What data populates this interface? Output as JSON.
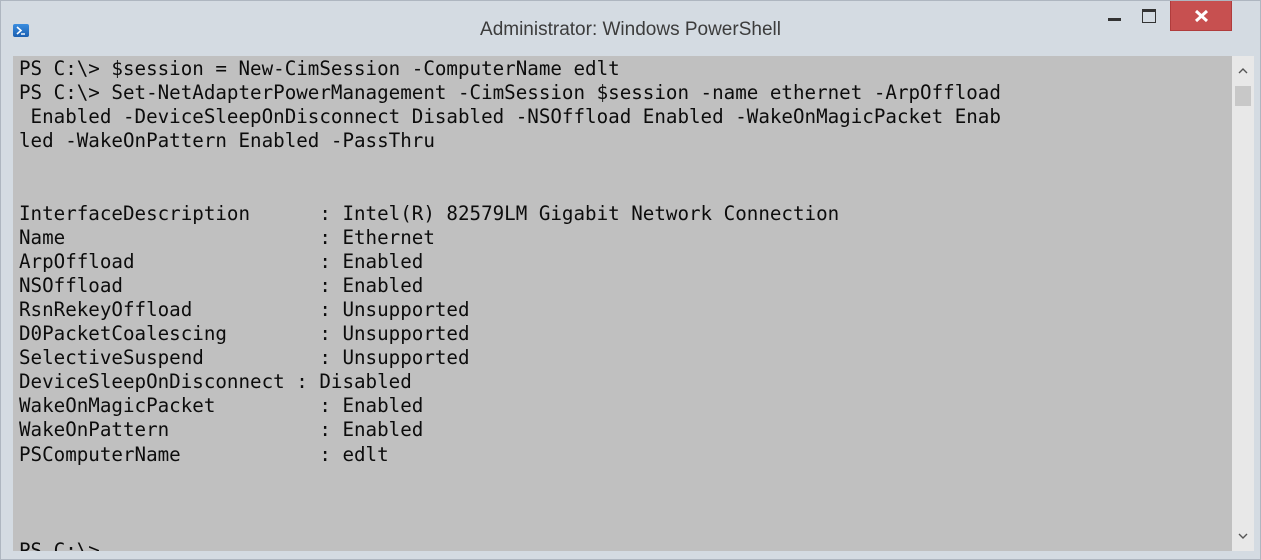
{
  "window": {
    "title": "Administrator: Windows PowerShell",
    "app_icon": "powershell-icon",
    "controls": {
      "minimize_icon": "minimize-icon",
      "maximize_icon": "maximize-icon",
      "close_icon": "close-icon",
      "close_color": "#c75050"
    }
  },
  "console": {
    "background_color": "#c0c0c0",
    "text_color": "#0c0c0c",
    "lines": [
      "PS C:\\> $session = New-CimSession -ComputerName edlt",
      "PS C:\\> Set-NetAdapterPowerManagement -CimSession $session -name ethernet -ArpOffload",
      " Enabled -DeviceSleepOnDisconnect Disabled -NSOffload Enabled -WakeOnMagicPacket Enab",
      "led -WakeOnPattern Enabled -PassThru",
      "",
      "",
      "InterfaceDescription      : Intel(R) 82579LM Gigabit Network Connection",
      "Name                      : Ethernet",
      "ArpOffload                : Enabled",
      "NSOffload                 : Enabled",
      "RsnRekeyOffload           : Unsupported",
      "D0PacketCoalescing        : Unsupported",
      "SelectiveSuspend          : Unsupported",
      "DeviceSleepOnDisconnect : Disabled",
      "WakeOnMagicPacket         : Enabled",
      "WakeOnPattern             : Enabled",
      "PSComputerName            : edlt",
      "",
      "",
      "",
      "PS C:\\>"
    ]
  },
  "scrollbar": {
    "up_icon": "scroll-up-arrow-icon",
    "down_icon": "scroll-down-arrow-icon"
  }
}
